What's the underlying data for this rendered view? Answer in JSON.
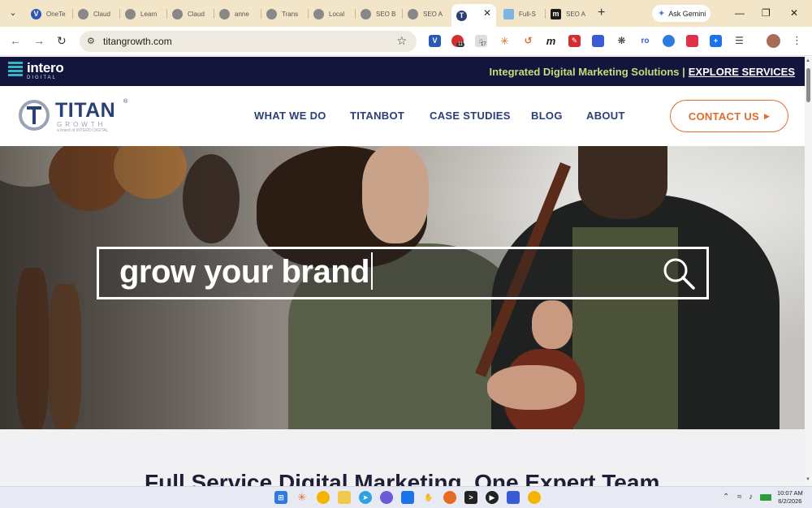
{
  "browser": {
    "tabs": [
      {
        "label": "OneTe",
        "icon": "v-icon"
      },
      {
        "label": "Claud",
        "icon": "globe-icon"
      },
      {
        "label": "Learn",
        "icon": "globe-icon"
      },
      {
        "label": "Claud",
        "icon": "globe-icon"
      },
      {
        "label": "anne",
        "icon": "globe-icon"
      },
      {
        "label": "Trans",
        "icon": "globe-icon"
      },
      {
        "label": "Local",
        "icon": "globe-icon"
      },
      {
        "label": "SEO B",
        "icon": "globe-icon"
      },
      {
        "label": "SEO A",
        "icon": "globe-icon"
      },
      {
        "label": "",
        "icon": "titan-icon",
        "active": true
      },
      {
        "label": "Full-S",
        "icon": "page-icon"
      },
      {
        "label": "SEO A",
        "icon": "m-icon"
      }
    ],
    "gemini_label": "Ask Gemini",
    "url": "titangrowth.com",
    "ext_badge_1": "11",
    "ext_badge_2": "17"
  },
  "site": {
    "brand_top": "intero",
    "brand_top_sub": "DIGITAL",
    "tagline": "Integrated Digital Marketing Solutions |",
    "explore_label": "EXPLORE SERVICES",
    "logo_word": "TITAN",
    "logo_growth": "GROWTH",
    "logo_sub": "a brand of INTERO DIGITAL",
    "nav": [
      "WHAT WE DO",
      "TITANBOT",
      "CASE STUDIES",
      "BLOG",
      "ABOUT"
    ],
    "contact_label": "CONTACT US",
    "hero_search_text": "grow your brand",
    "section_heading": "Full Service Digital Marketing. One Expert Team"
  },
  "taskbar": {
    "time": "10:07 AM",
    "date": "6/2/2026"
  },
  "colors": {
    "tabstrip": "#f3e6c8",
    "topbar": "#13153d",
    "navy": "#2a3f77",
    "accent": "#e36a2a",
    "tagline": "#c7dc7a"
  }
}
